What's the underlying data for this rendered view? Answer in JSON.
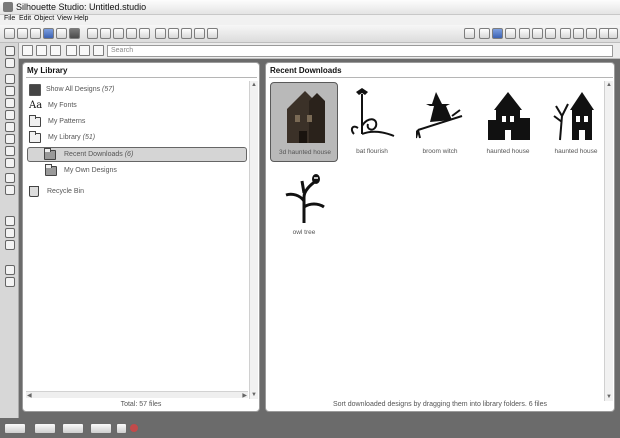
{
  "window": {
    "title": "Silhouette Studio: Untitled.studio"
  },
  "menu": [
    "File",
    "Edit",
    "Object",
    "View",
    "Help"
  ],
  "search": {
    "placeholder": "Search"
  },
  "library": {
    "title": "My Library",
    "items": [
      {
        "label": "Show All Designs",
        "count": "(57)"
      },
      {
        "label": "My Fonts"
      },
      {
        "label": "My Patterns"
      },
      {
        "label": "My Library",
        "count": "(51)"
      },
      {
        "label": "Recent Downloads",
        "count": "(6)"
      },
      {
        "label": "My Own Designs"
      },
      {
        "label": "Recycle Bin"
      }
    ],
    "total": "Total: 57 files"
  },
  "downloads": {
    "title": "Recent Downloads",
    "items": [
      {
        "label": "3d haunted house"
      },
      {
        "label": "bat flourish"
      },
      {
        "label": "broom witch"
      },
      {
        "label": "haunted house"
      },
      {
        "label": "haunted house"
      },
      {
        "label": "owl tree"
      }
    ],
    "footer": "Sort downloaded designs by dragging them into library folders. 6 files"
  },
  "colors": {
    "accent": "#3c62b3",
    "selection": "#b9b9b9"
  }
}
